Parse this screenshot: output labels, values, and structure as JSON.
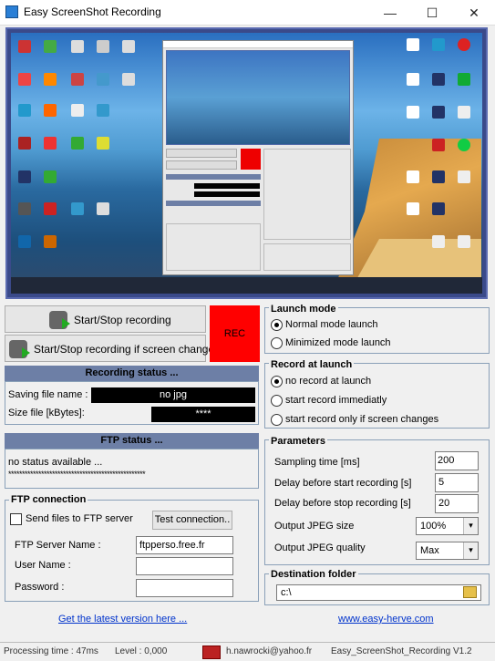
{
  "window": {
    "title": "Easy ScreenShot Recording",
    "minimize_icon": "minimize-icon",
    "maximize_icon": "maximize-icon",
    "close_icon": "close-icon",
    "minimize_glyph": "—",
    "maximize_glyph": "☐",
    "close_glyph": "✕"
  },
  "controls": {
    "start_stop": "Start/Stop recording",
    "start_stop_changes": "Start/Stop recording if screen changes",
    "rec": "REC",
    "rec_color": "#ff0000"
  },
  "recording_status": {
    "header": "Recording status ...",
    "saving_label": "Saving file name :",
    "saving_value": "no jpg",
    "size_label": "Size file [kBytes]:",
    "size_value": "****"
  },
  "ftp_status": {
    "header": "FTP status ...",
    "text": "no status available ...",
    "stars": "**************************************************"
  },
  "ftp_connection": {
    "title": "FTP connection",
    "send_label": "Send files to FTP server",
    "send_checked": false,
    "test_button": "Test connection..",
    "server_label": "FTP Server Name :",
    "server_value": "ftpperso.free.fr",
    "user_label": "User Name :",
    "user_value": "",
    "password_label": "Password :",
    "password_value": ""
  },
  "launch_mode": {
    "title": "Launch mode",
    "options": [
      "Normal mode launch",
      "Minimized mode launch"
    ],
    "selected": 0
  },
  "record_at_launch": {
    "title": "Record at launch",
    "options": [
      "no record at launch",
      "start record immediatly",
      "start record only if screen changes"
    ],
    "selected": 0
  },
  "parameters": {
    "title": "Parameters",
    "sampling_label": "Sampling time [ms]",
    "sampling_value": "200",
    "delay_start_label": "Delay before start recording [s]",
    "delay_start_value": "5",
    "delay_stop_label": "Delay before stop recording [s]",
    "delay_stop_value": "20",
    "jpeg_size_label": "Output JPEG size",
    "jpeg_size_value": "100%",
    "jpeg_quality_label": "Output JPEG quality",
    "jpeg_quality_value": "Max"
  },
  "destination": {
    "title": "Destination folder",
    "value": "c:\\",
    "folder_icon": "folder-icon"
  },
  "links": {
    "latest": "Get the latest version here ...",
    "website": "www.easy-herve.com"
  },
  "statusbar": {
    "processing": "Processing time : 47ms",
    "level": "Level : 0,000",
    "email": "h.nawrocki@yahoo.fr",
    "version": "Easy_ScreenShot_Recording V1.2"
  }
}
